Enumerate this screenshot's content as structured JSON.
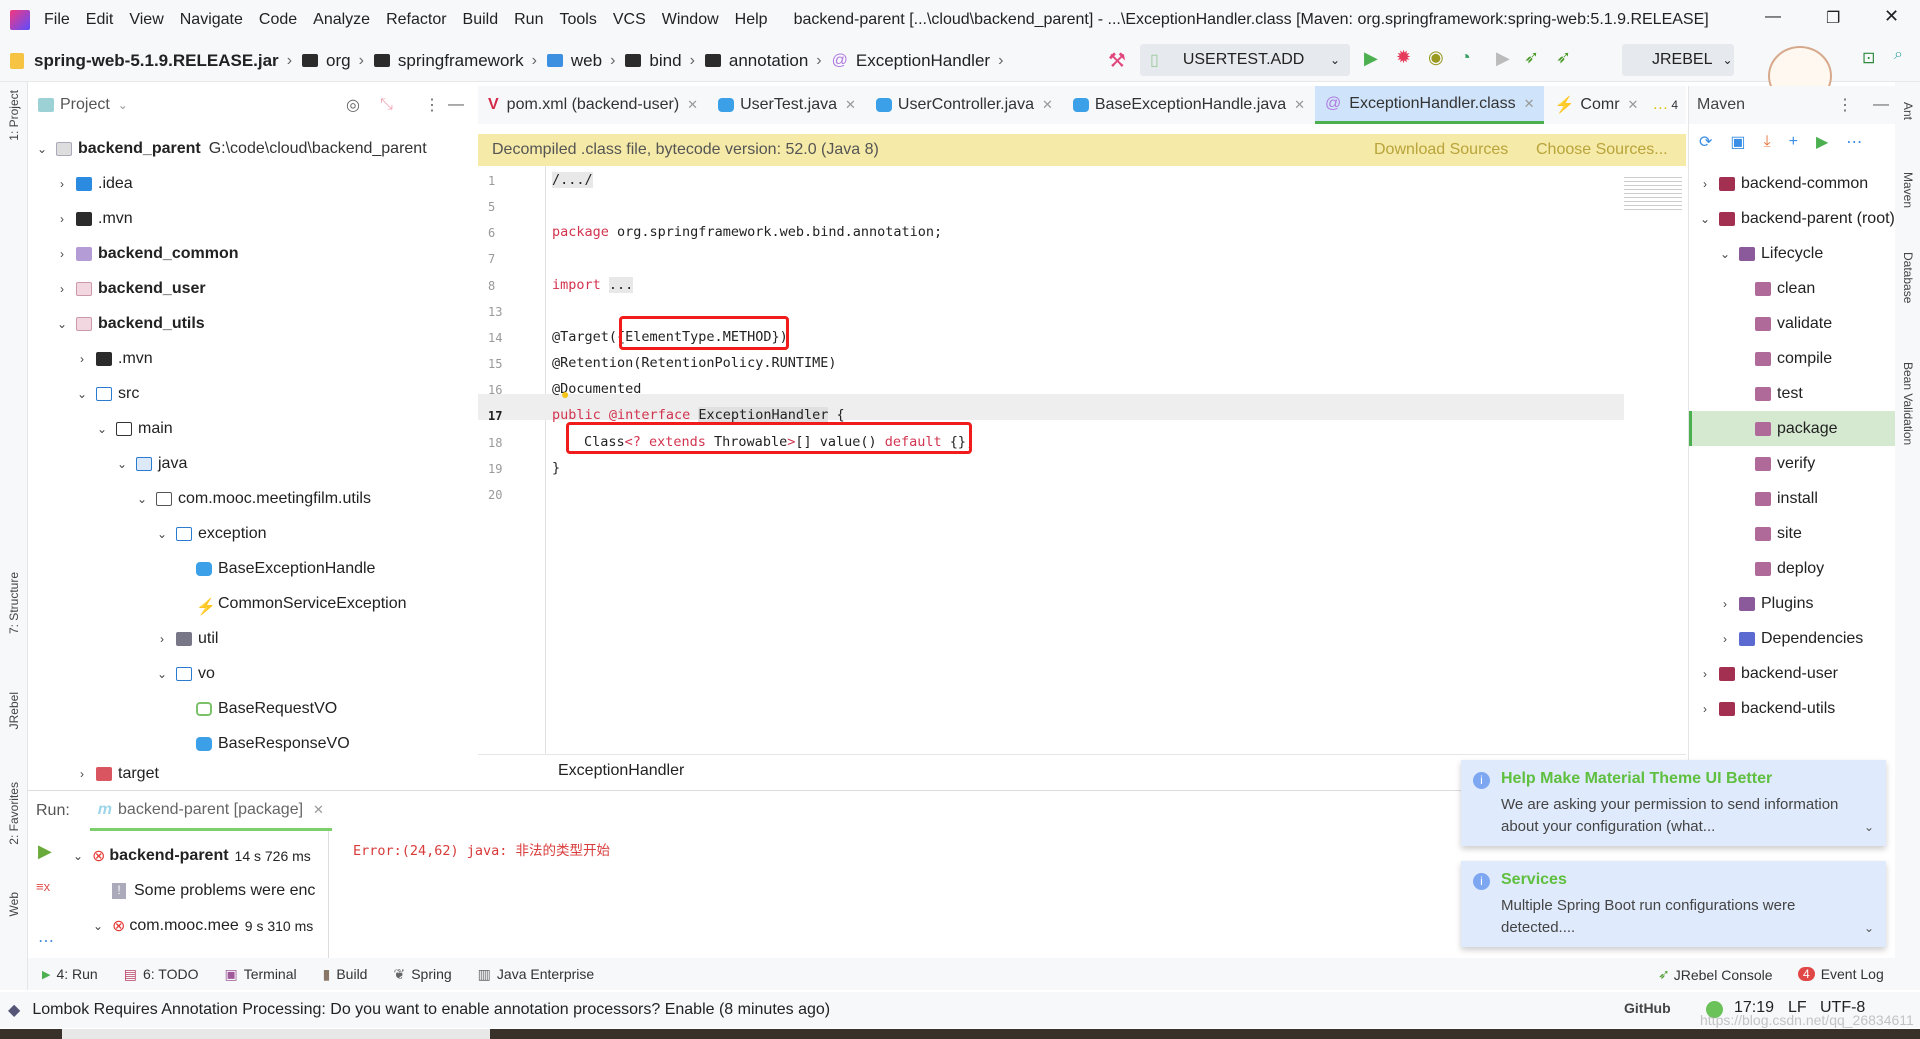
{
  "menubar": {
    "items": [
      "File",
      "Edit",
      "View",
      "Navigate",
      "Code",
      "Analyze",
      "Refactor",
      "Build",
      "Run",
      "Tools",
      "VCS",
      "Window",
      "Help"
    ],
    "title": "backend-parent [...\\cloud\\backend_parent] - ...\\ExceptionHandler.class [Maven: org.springframework:spring-web:5.1.9.RELEASE]"
  },
  "navbar": {
    "crumbs": [
      "spring-web-5.1.9.RELEASE.jar",
      "org",
      "springframework",
      "web",
      "bind",
      "annotation",
      "ExceptionHandler"
    ],
    "run_config": "USERTEST.ADD",
    "jrebel": "JREBEL"
  },
  "sidestrip": {
    "left": [
      "1: Project",
      "7: Structure",
      "JRebel",
      "2: Favorites",
      "Web"
    ],
    "right": [
      "Ant",
      "Maven",
      "Database",
      "Bean Validation"
    ]
  },
  "project": {
    "title": "Project",
    "root_label": "backend_parent",
    "root_path": "G:\\code\\cloud\\backend_parent",
    "items": [
      ".idea",
      ".mvn",
      "backend_common",
      "backend_user",
      "backend_utils",
      ".mvn",
      "src",
      "main",
      "java",
      "com.mooc.meetingfilm.utils",
      "exception",
      "BaseExceptionHandle",
      "CommonServiceException",
      "util",
      "vo",
      "BaseRequestVO",
      "BaseResponseVO",
      "target"
    ]
  },
  "tabs": [
    "pom.xml (backend-user)",
    "UserTest.java",
    "UserController.java",
    "BaseExceptionHandle.java",
    "ExceptionHandler.class",
    "Comr",
    "4"
  ],
  "active_tab": "ExceptionHandler.class",
  "notice": {
    "text": "Decompiled .class file, bytecode version: 52.0 (Java 8)",
    "download": "Download Sources",
    "choose": "Choose Sources..."
  },
  "editor": {
    "line_numbers": [
      "1",
      "5",
      "6",
      "7",
      "8",
      "13",
      "14",
      "15",
      "16",
      "17",
      "18",
      "19",
      "20"
    ],
    "current_line": "17",
    "breadcrumb": "ExceptionHandler",
    "code": {
      "l1": "/.../",
      "l6_kw": "package",
      "l6": " org.springframework.web.bind.annotation;",
      "l8_kw": "import",
      "l8": "...",
      "l14a": "@Target({",
      "l14b": "ElementType.METHOD})",
      "l15": "@Retention(RetentionPolicy.RUNTIME)",
      "l16": "@Documented",
      "l17_kw1": "public",
      "l17_kw2": "@interface",
      "l17_name": "ExceptionHandler",
      "l17_end": " {",
      "l18a": "Class",
      "l18b": "<? extends ",
      "l18c": "Throwable",
      "l18d": ">",
      "l18e": "[] value() ",
      "l18f": "default",
      "l18g": " {};",
      "l19": "}"
    }
  },
  "maven": {
    "title": "Maven",
    "items": [
      "backend-common",
      "backend-parent (root)",
      "Lifecycle",
      "clean",
      "validate",
      "compile",
      "test",
      "package",
      "verify",
      "install",
      "site",
      "deploy",
      "Plugins",
      "Dependencies",
      "backend-user",
      "backend-utils"
    ],
    "selected": "package"
  },
  "run": {
    "label": "Run:",
    "tab": "backend-parent [package]",
    "tree": [
      {
        "label": "backend-parent",
        "time": "14 s 726 ms"
      },
      {
        "label": "Some problems were enc",
        "time": ""
      },
      {
        "label": "com.mooc.mee",
        "time": "9 s 310 ms"
      }
    ],
    "error": "Error:(24,62) java: 非法的类型开始"
  },
  "toolwindows": [
    "4: Run",
    "6: TODO",
    "Terminal",
    "Build",
    "Spring",
    "Java Enterprise"
  ],
  "toolwindows_right": {
    "jrebel": "JRebel Console",
    "event_log": "Event Log",
    "event_count": "4"
  },
  "notifications": [
    {
      "title": "Help Make Material Theme UI Better",
      "body": "We are asking your permission to send information about your configuration (what..."
    },
    {
      "title": "Services",
      "body": "Multiple Spring Boot run configurations were detected...."
    }
  ],
  "status": {
    "message": "Lombok Requires Annotation Processing: Do you want to enable annotation processors? Enable (8 minutes ago)",
    "github": "GitHub",
    "position": "17:19",
    "line_sep": "LF",
    "encoding": "UTF-8",
    "watermark": "https://blog.csdn.net/qq_26834611"
  },
  "colors": {
    "accent_green": "#4caf50",
    "error_red": "#e53935",
    "keyword": "#d2344f",
    "notice_bg": "#f5eaa8",
    "selection": "#cfe4fa"
  }
}
